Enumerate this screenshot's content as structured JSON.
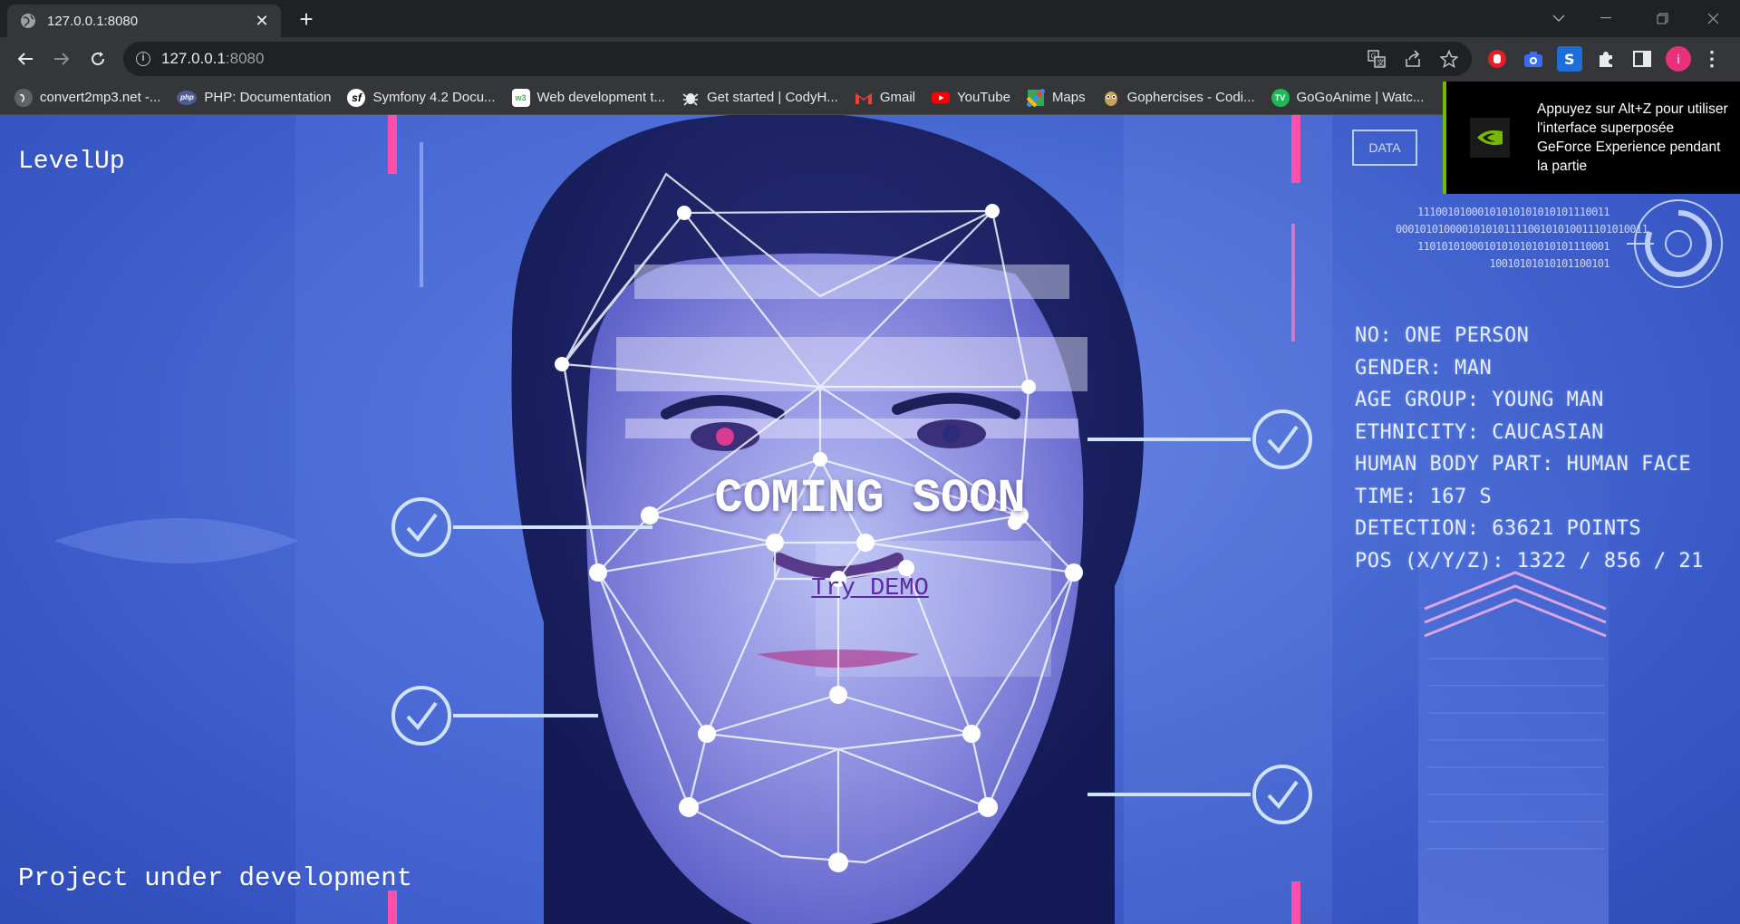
{
  "browser": {
    "tab": {
      "title": "127.0.0.1:8080",
      "icon": "globe-icon"
    },
    "address": {
      "host": "127.0.0.1",
      "port": ":8080"
    },
    "bookmarks": [
      {
        "label": "convert2mp3.net -...",
        "icon": "globe-icon",
        "color": "#5f6368"
      },
      {
        "label": "PHP: Documentation",
        "icon": "php-icon",
        "color": "#4f5b93"
      },
      {
        "label": "Symfony 4.2 Docu...",
        "icon": "symfony-icon",
        "color": "#000000"
      },
      {
        "label": "Web development t...",
        "icon": "w3schools-icon",
        "color": "#ffffff"
      },
      {
        "label": "Get started | CodyH...",
        "icon": "bug-icon",
        "color": "#35363a"
      },
      {
        "label": "Gmail",
        "icon": "gmail-icon",
        "color": "#ffffff"
      },
      {
        "label": "YouTube",
        "icon": "youtube-icon",
        "color": "#ff0000"
      },
      {
        "label": "Maps",
        "icon": "maps-icon",
        "color": "#34a853"
      },
      {
        "label": "Gophercises - Codi...",
        "icon": "gopher-icon",
        "color": "#c9a15a"
      },
      {
        "label": "GoGoAnime | Watc...",
        "icon": "gogoanime-icon",
        "color": "#1db954"
      }
    ]
  },
  "page": {
    "brand": "LevelUp",
    "headline": "COMING SOON",
    "demo_link": "Try DEMO",
    "footer_note": "Project under development",
    "hud_lines": [
      "NO: ONE PERSON",
      "GENDER: MAN",
      "AGE GROUP: YOUNG MAN",
      "ETHNICITY: CAUCASIAN",
      "HUMAN BODY PART: HUMAN FACE",
      "TIME: 167 S",
      "DETECTION: 63621 POINTS",
      "POS (X/Y/Z): 1322 / 856 / 21"
    ],
    "data_tag": "DATA",
    "binary_lines": [
      "11100101000101010101010101110011",
      "000101010000101010111100101010011101010011",
      "11010101000101010101010101110001",
      "10010101010101100101"
    ]
  },
  "overlay": {
    "text": "Appuyez sur Alt+Z pour utiliser l'interface superposée GeForce Experience pendant la partie",
    "accent": "#76b900"
  }
}
